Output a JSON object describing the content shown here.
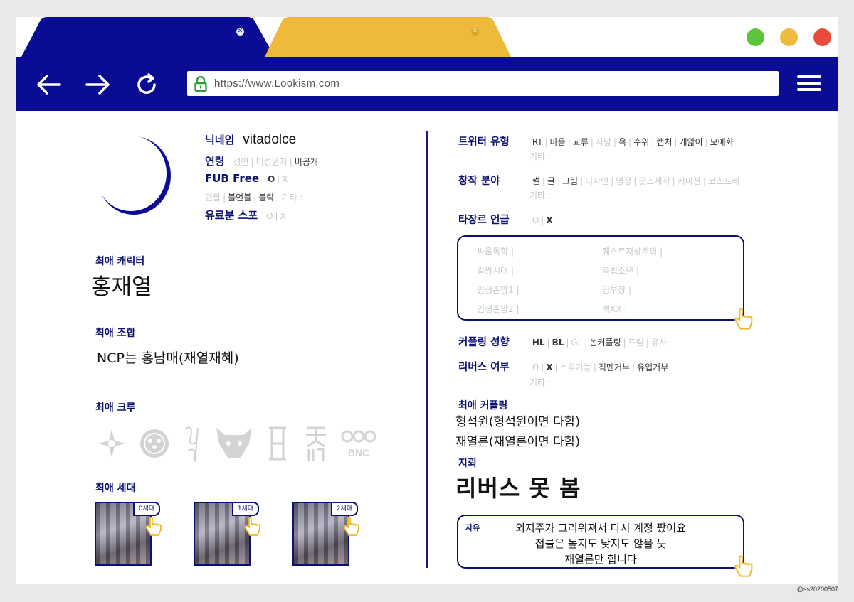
{
  "browser": {
    "url": "https://www.Lookism.com",
    "colors": {
      "nav": "#0a0d93",
      "tab_active": "#0a0d93",
      "tab_inactive": "#efb93c",
      "traffic": [
        "#5fc43c",
        "#efb93c",
        "#e74c3c"
      ]
    }
  },
  "profile": {
    "nickname_label": "닉네임",
    "nickname": "vitadolce",
    "age_label": "연령",
    "age_options": [
      "성인",
      "미성년자",
      "비공개"
    ],
    "fub_label": "FUB Free",
    "fub_o": "O",
    "fub_x": "X",
    "fub_sub": [
      "언팔",
      "블언블",
      "블락",
      "기타 :"
    ],
    "paid_label": "유료분 스포",
    "paid_o": "O",
    "paid_x": "X"
  },
  "favorite_character": {
    "title": "최애 캐릭터",
    "value": "홍재열"
  },
  "favorite_combo": {
    "title": "최애 조합",
    "value": "NCP는 홍남매(재열재혜)"
  },
  "favorite_crew": {
    "title": "최애 크루"
  },
  "favorite_generation": {
    "title": "최애 세대",
    "cards": [
      "0세대",
      "1세대",
      "2세대"
    ]
  },
  "twitter_type": {
    "label": "트위터 유형",
    "items": [
      "RT",
      "마음",
      "교류",
      "사담",
      "욕",
      "수위",
      "캡처",
      "캐얇이",
      "모예화"
    ],
    "other": "기타 :"
  },
  "creation": {
    "label": "창작 분야",
    "items": [
      "썰",
      "글",
      "그림",
      "디자인",
      "영상",
      "굿즈제작",
      "커미션",
      "코스프레"
    ],
    "other": "기타 :"
  },
  "other_genre": {
    "label": "타장르 언급",
    "o": "O",
    "x": "X",
    "list_left": [
      "싸움독학 |",
      "일짱시대 |",
      "인생존망1 |",
      "인생존망2 |"
    ],
    "list_right": [
      "퀘스트지상주의 |",
      "측법소년 |",
      "김부장 |",
      "백XX |"
    ]
  },
  "coupling_tendency": {
    "label": "커플링 성향",
    "items": [
      "HL",
      "BL",
      "GL",
      "논커플링",
      "드림",
      "유사"
    ]
  },
  "reverse": {
    "label": "리버스 여부",
    "items": [
      "O",
      "X",
      "스루가능",
      "직멘거부",
      "유입거부"
    ],
    "other": "기타 :"
  },
  "favorite_coupling": {
    "title": "최애 커플링",
    "line1": "형석윈(형석윈이면 다함)",
    "line2": "재열른(재열른이면 다함)"
  },
  "landmine": {
    "title": "지뢰",
    "value": "리버스 못 봄"
  },
  "free_text": {
    "label": "자유",
    "lines": [
      "외지주가 그리워져서 다시 계정 팠어요",
      "접률은 높지도 낮지도 않을 듯",
      "재열른만 합니다"
    ]
  },
  "credit": "@ss20200507"
}
